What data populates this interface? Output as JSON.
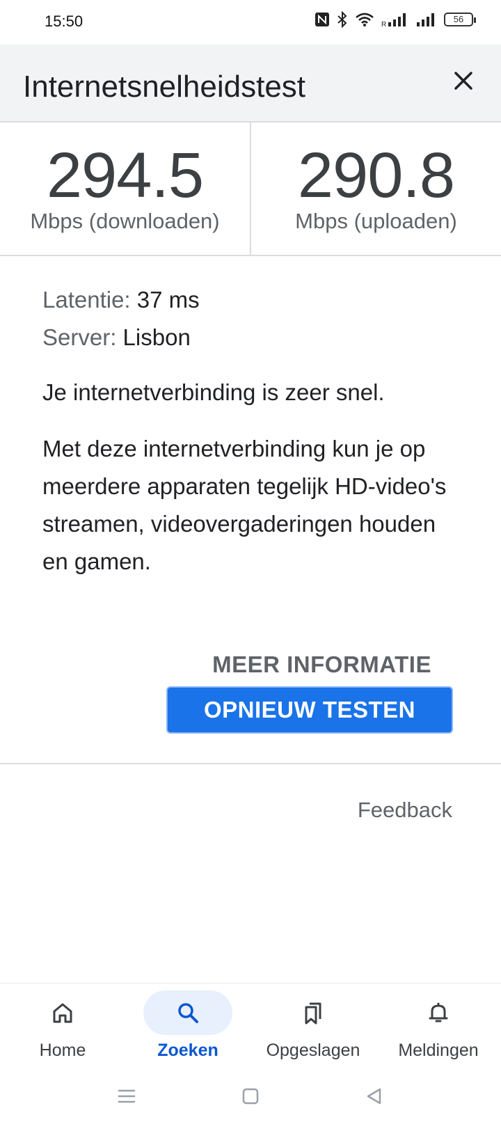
{
  "status_bar": {
    "time": "15:50",
    "battery_level": "56",
    "icons": [
      "nfc-icon",
      "bluetooth-icon",
      "wifi-icon",
      "signal-roaming-icon",
      "signal-icon",
      "battery-icon"
    ]
  },
  "header": {
    "title": "Internetsnelheidstest",
    "close_icon": "close-icon"
  },
  "results": {
    "download": {
      "value": "294.5",
      "unit": "Mbps (downloaden)"
    },
    "upload": {
      "value": "290.8",
      "unit": "Mbps (uploaden)"
    }
  },
  "details": {
    "latency_label": "Latentie:",
    "latency_value": "37 ms",
    "server_label": "Server:",
    "server_value": "Lisbon",
    "verdict": "Je internetverbinding is zeer snel.",
    "explanation": "Met deze internetverbinding kun je op meerdere apparaten tegelijk HD-video's streamen, videovergaderingen houden en gamen."
  },
  "actions": {
    "more_info": "MEER INFORMATIE",
    "retest": "OPNIEUW TESTEN",
    "feedback": "Feedback"
  },
  "colors": {
    "accent": "#1a73e8",
    "header_bg": "#f1f3f4",
    "active_nav_text": "#0b57d0",
    "active_nav_pill": "#e8f0fe"
  },
  "bottom_nav": {
    "items": [
      {
        "label": "Home",
        "icon": "home-icon",
        "active": false
      },
      {
        "label": "Zoeken",
        "icon": "search-icon",
        "active": true
      },
      {
        "label": "Opgeslagen",
        "icon": "bookmarks-icon",
        "active": false
      },
      {
        "label": "Meldingen",
        "icon": "bell-icon",
        "active": false
      }
    ]
  },
  "system_nav": {
    "icons": [
      "recents-icon",
      "home-square-icon",
      "back-triangle-icon"
    ]
  }
}
